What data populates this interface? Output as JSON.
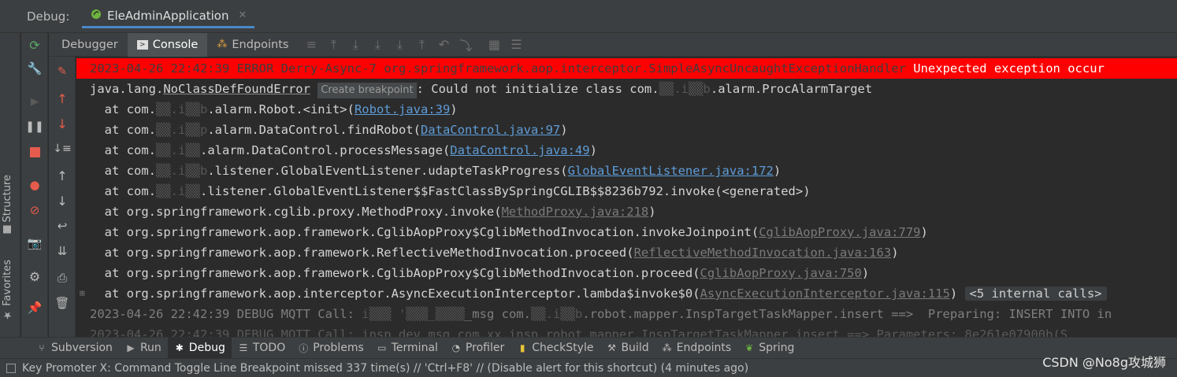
{
  "topbar": {
    "debug_label": "Debug:",
    "app_tab": "EleAdminApplication",
    "close": "✕"
  },
  "left_stripe": {
    "structure": "Structure",
    "favorites": "Favorites"
  },
  "tabs": {
    "debugger": "Debugger",
    "console": "Console",
    "endpoints": "Endpoints"
  },
  "console": {
    "error_line": {
      "timestamp": "2023-04-26 22:42:39",
      "level": "ERROR",
      "thread": "Derry-Async-7",
      "logger": "org.springframework.aop.interceptor.SimpleAsyncUncaughtExceptionHandler",
      "message": "Unexpected exception occur"
    },
    "exception": {
      "prefix": "java.lang.",
      "name": "NoClassDefFoundError",
      "tooltip": "Create breakpoint",
      "rest": ": Could not initialize class com.",
      "rest2": ".alarm.ProcAlarmTarget"
    },
    "frames": [
      {
        "pre": "  at com.",
        "mid": ".alarm.Robot.<init>(",
        "link": "Robot.java:39",
        "post": ")",
        "lib": false
      },
      {
        "pre": "  at com.",
        "mid": ".alarm.DataControl.findRobot(",
        "link": "DataControl.java:97",
        "post": ")",
        "lib": false
      },
      {
        "pre": "  at com.",
        "mid": ".alarm.DataControl.processMessage(",
        "link": "DataControl.java:49",
        "post": ")",
        "lib": false
      },
      {
        "pre": "  at com.",
        "mid": ".listener.GlobalEventListener.udapteTaskProgress(",
        "link": "GlobalEventListener.java:172",
        "post": ")",
        "lib": false
      },
      {
        "pre": "  at com.",
        "mid": ".listener.GlobalEventListener$$FastClassBySpringCGLIB$$8236b792.invoke(<generated>)",
        "link": "",
        "post": "",
        "lib": false
      },
      {
        "pre": "  at org.springframework.cglib.proxy.MethodProxy.invoke(",
        "mid": "",
        "link": "MethodProxy.java:218",
        "post": ")",
        "lib": true
      },
      {
        "pre": "  at org.springframework.aop.framework.CglibAopProxy$CglibMethodInvocation.invokeJoinpoint(",
        "mid": "",
        "link": "CglibAopProxy.java:779",
        "post": ")",
        "lib": true
      },
      {
        "pre": "  at org.springframework.aop.framework.ReflectiveMethodInvocation.proceed(",
        "mid": "",
        "link": "ReflectiveMethodInvocation.java:163",
        "post": ")",
        "lib": true
      },
      {
        "pre": "  at org.springframework.aop.framework.CglibAopProxy$CglibMethodInvocation.proceed(",
        "mid": "",
        "link": "CglibAopProxy.java:750",
        "post": ")",
        "lib": true
      },
      {
        "pre": "  at org.springframework.aop.interceptor.AsyncExecutionInterceptor.lambda$invoke$0(",
        "mid": "",
        "link": "AsyncExecutionInterceptor.java:115",
        "post": ")",
        "lib": true
      }
    ],
    "internal_calls": "<5 internal calls>",
    "debug_line": "2023-04-26 22:42:39 DEBUG MQTT Call:",
    "debug_line_rest": "_msg com.",
    "debug_line_rest2": ".robot.mapper.InspTargetTaskMapper.insert ==>  Preparing: INSERT INTO in",
    "debug_line2": "2023-04-26 22:42:39 DEBUG MQTT Call: insp_dev_msg com.xx.insp.robot.mapper.InspTargetTaskMapper.insert ==> Parameters: 8e261e07900b(S"
  },
  "bottom_tabs": [
    "Subversion",
    "Run",
    "Debug",
    "TODO",
    "Problems",
    "Terminal",
    "Profiler",
    "CheckStyle",
    "Build",
    "Endpoints",
    "Spring"
  ],
  "status": {
    "text": "Key Promoter X: Command Toggle Line Breakpoint missed 337 time(s) // 'Ctrl+F8' // (Disable alert for this shortcut) (4 minutes ago)"
  },
  "watermark": "CSDN @No8g攻城狮",
  "colors": {
    "error_bg": "#ff0000",
    "link": "#5e9cd7",
    "console_bg": "#2b2b2b",
    "panel_bg": "#3c3f41"
  }
}
